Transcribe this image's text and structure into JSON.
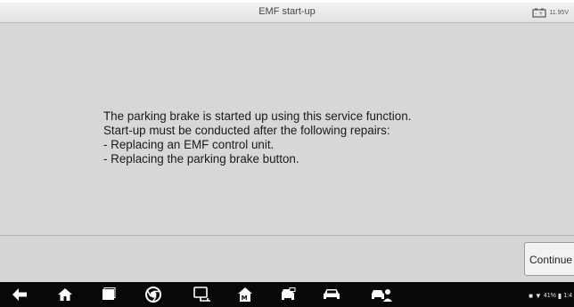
{
  "header": {
    "title": "EMF start-up",
    "battery_voltage": "11.95V",
    "battery_icon": "car-battery-icon"
  },
  "main": {
    "message_lines": [
      "The parking brake is started up using this service function.",
      "Start-up must be conducted after the following repairs:",
      "- Replacing an EMF control unit.",
      "- Replacing the parking brake button."
    ]
  },
  "actions": {
    "continue_label": "Continue"
  },
  "navbar": {
    "icons": [
      "back-icon",
      "home-icon",
      "recent-apps-icon",
      "chrome-icon",
      "vci-connection-icon",
      "maxisys-home-icon",
      "vehicle-diagnostics-icon",
      "car-icon",
      "vehicle-services-icon"
    ],
    "status": {
      "battery_percent": "41%",
      "time": "1:4"
    }
  },
  "colors": {
    "background": "#d7d7d7",
    "navbar": "#080808"
  }
}
